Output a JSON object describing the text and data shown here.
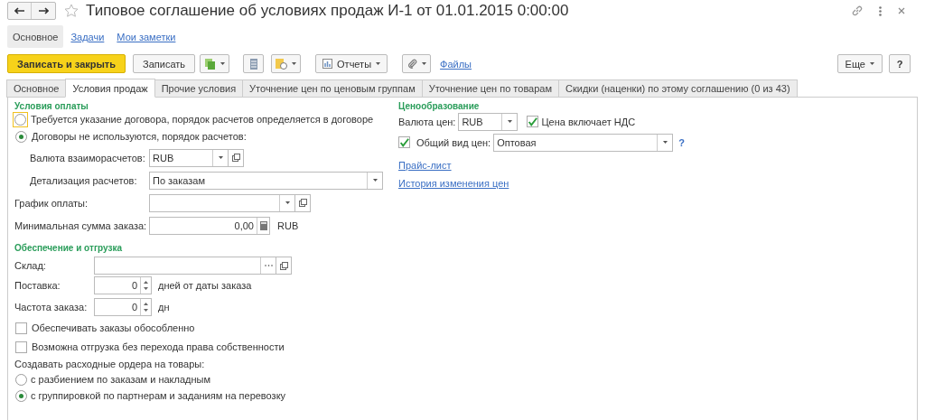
{
  "window": {
    "title": "Типовое соглашение об условиях продаж И-1 от 01.01.2015 0:00:00"
  },
  "nav_tabs": [
    {
      "label": "Основное",
      "selected": true
    },
    {
      "label": "Задачи",
      "selected": false
    },
    {
      "label": "Мои заметки",
      "selected": false
    }
  ],
  "toolbar": {
    "primary": "Записать и закрыть",
    "save": "Записать",
    "reports": "Отчеты",
    "files": "Файлы",
    "more": "Еще",
    "help": "?"
  },
  "tabs": [
    {
      "label": "Основное",
      "selected": false
    },
    {
      "label": "Условия продаж",
      "selected": true
    },
    {
      "label": "Прочие условия",
      "selected": false
    },
    {
      "label": "Уточнение цен по ценовым группам",
      "selected": false
    },
    {
      "label": "Уточнение цен по товарам",
      "selected": false
    },
    {
      "label": "Скидки (наценки) по этому соглашению (0 из 43)",
      "selected": false
    }
  ],
  "payment": {
    "heading": "Условия оплаты",
    "options": [
      {
        "label": "Требуется указание договора, порядок расчетов определяется в договоре",
        "selected": false,
        "focused": true
      },
      {
        "label": "Договоры не используются, порядок расчетов:",
        "selected": true,
        "focused": false
      }
    ],
    "fields": [
      {
        "label": "Валюта взаиморасчетов:",
        "value": "RUB",
        "kind": "combo",
        "indent": true
      },
      {
        "label": "Детализация расчетов:",
        "value": "По заказам",
        "kind": "select",
        "indent": true
      },
      {
        "label": "График оплаты:",
        "kind": "combo",
        "indent": false
      },
      {
        "label": "Минимальная сумма заказа:",
        "value": "0,00",
        "kind": "number",
        "suffix": "RUB",
        "indent": false
      }
    ]
  },
  "shipping": {
    "heading": "Обеспечение и отгрузка",
    "fields": [
      {
        "label": "Склад:",
        "kind": "choice"
      },
      {
        "label": "Поставка:",
        "value": "0",
        "kind": "spin",
        "suffix": "дней от даты заказа"
      },
      {
        "label": "Частота заказа:",
        "value": "0",
        "kind": "spin",
        "suffix": "дн"
      }
    ],
    "checkboxes": [
      {
        "label": "Обеспечивать заказы обособленно",
        "checked": false
      },
      {
        "label": "Возможна отгрузка без перехода права собственности",
        "checked": false
      }
    ],
    "orders_label": "Создавать расходные ордера на товары:",
    "orders_options": [
      {
        "label": "с разбиением по заказам и накладным",
        "selected": false
      },
      {
        "label": "с группировкой по партнерам и заданиям на перевозку",
        "selected": true
      }
    ]
  },
  "pricing": {
    "heading": "Ценообразование",
    "currency_label": "Валюта цен:",
    "currency": "RUB",
    "vat": {
      "label": "Цена включает НДС",
      "checked": true
    },
    "price_type": {
      "checked": true,
      "label": "Общий вид цен:",
      "value": "Оптовая",
      "help": "?"
    },
    "links": [
      "Прайс-лист",
      "История изменения цен"
    ]
  }
}
